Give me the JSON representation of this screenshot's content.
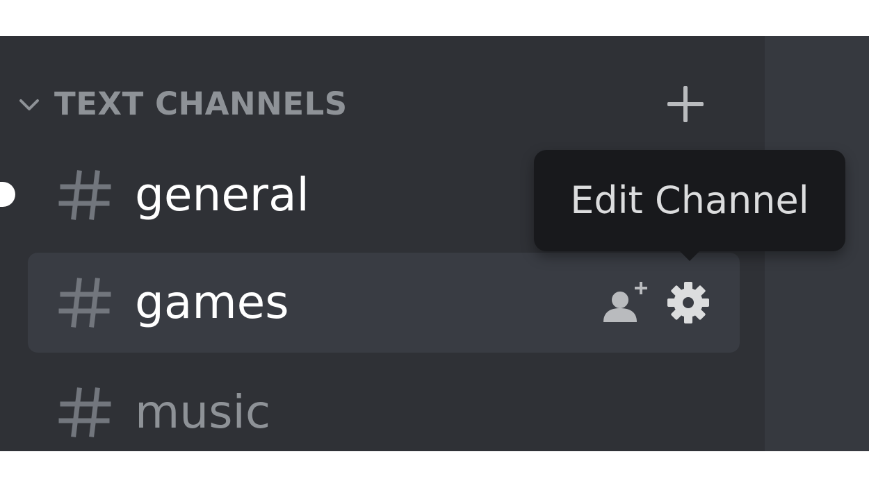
{
  "category": {
    "label": "TEXT CHANNELS",
    "chevron_icon": "chevron-down-icon",
    "add_icon": "plus-icon"
  },
  "channels": [
    {
      "name": "general",
      "icon": "hash-icon",
      "state": "unread"
    },
    {
      "name": "games",
      "icon": "hash-icon",
      "state": "hovered"
    },
    {
      "name": "music",
      "icon": "hash-icon",
      "state": "muted"
    }
  ],
  "channel_actions": {
    "invite_icon": "add-user-icon",
    "settings_icon": "gear-icon"
  },
  "tooltip": {
    "text": "Edit Channel"
  },
  "colors": {
    "sidebar_bg": "#2f3136",
    "hover_bg": "#393c43",
    "tooltip_bg": "#18191c",
    "muted_text": "#8e9297",
    "active_text": "#ffffff"
  }
}
